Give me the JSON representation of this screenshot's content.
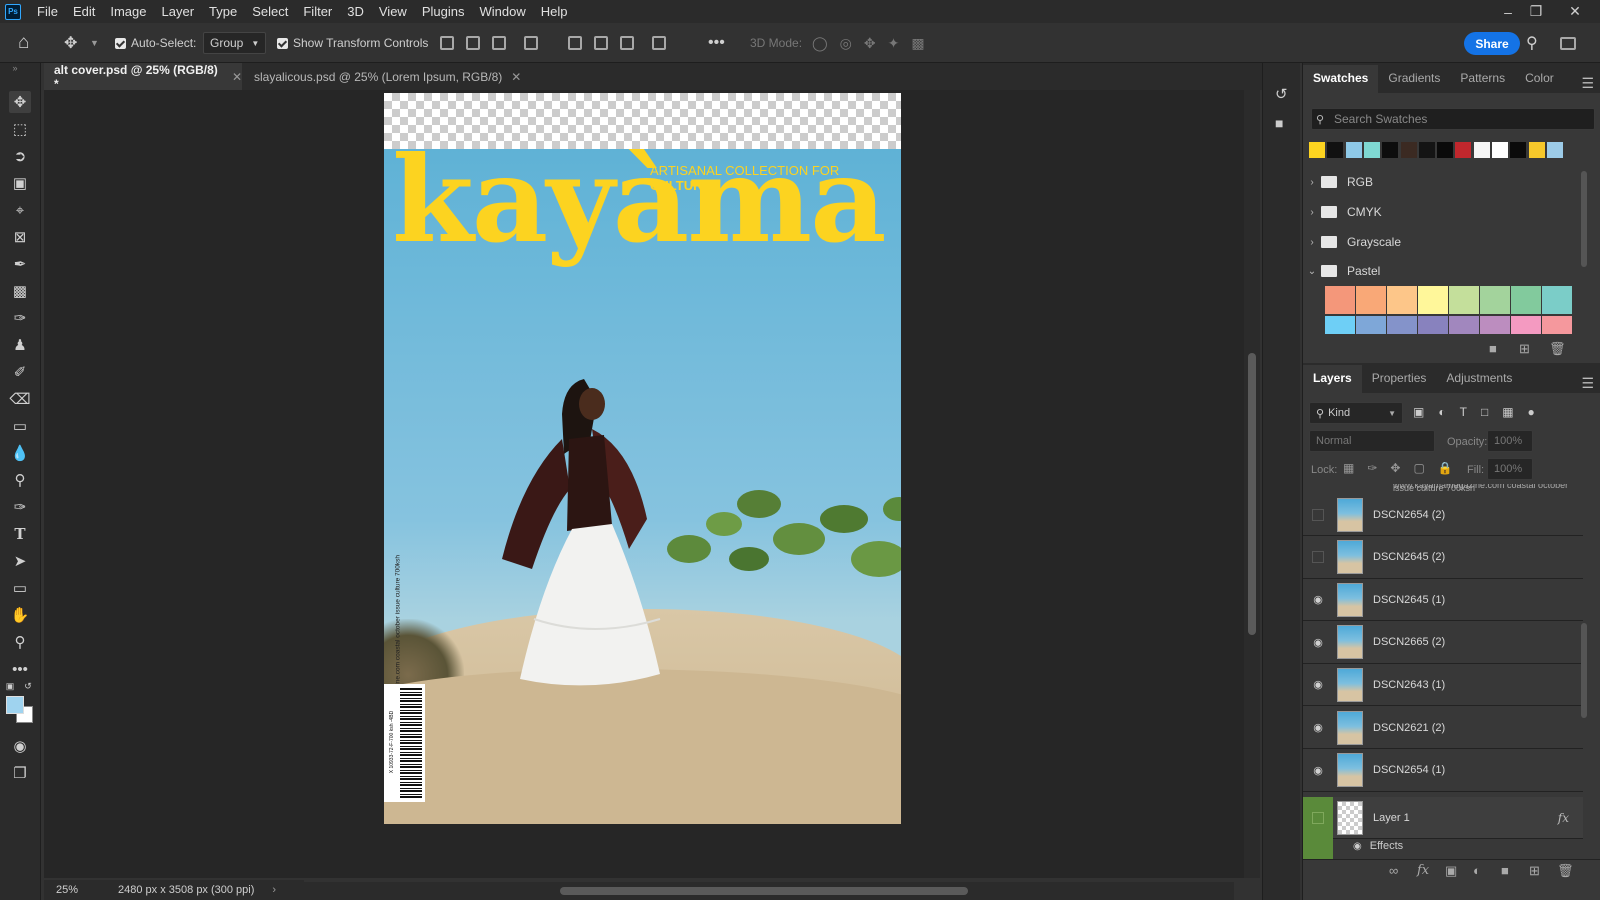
{
  "menu": {
    "logo": "Ps",
    "items": [
      "File",
      "Edit",
      "Image",
      "Layer",
      "Type",
      "Select",
      "Filter",
      "3D",
      "View",
      "Plugins",
      "Window",
      "Help"
    ]
  },
  "options": {
    "auto_select_label": "Auto-Select:",
    "auto_select_value": "Group",
    "transform_label": "Show Transform Controls",
    "mode_3d_label": "3D Mode:",
    "share_label": "Share"
  },
  "tabs": [
    {
      "label": "alt cover.psd @ 25% (RGB/8) *"
    },
    {
      "label": "slayalicous.psd @ 25% (Lorem Ipsum, RGB/8)"
    }
  ],
  "cover": {
    "masthead": "kayàma",
    "tagline_pre": "ARTISANAL COLLECTION FOR ",
    "tagline_bold": "CULTURE",
    "spine": "www.kayamamagazine.com coastal october issue culture 700ksh",
    "barcode_num": "X 10933-72-F-700 ksh -4BD"
  },
  "status": {
    "zoom": "25%",
    "doc_info": "2480 px x 3508 px (300 ppi)"
  },
  "swatches_panel": {
    "tabs": [
      "Swatches",
      "Gradients",
      "Patterns",
      "Color"
    ],
    "search_placeholder": "Search Swatches",
    "top_colors": [
      "#fcd320",
      "#111111",
      "#8ec9e8",
      "#7fd8d2",
      "#0d0d0d",
      "#3b2a22",
      "#141414",
      "#0a0a0a",
      "#c1272d",
      "#f4f4f4",
      "#ffffff",
      "#0b0b0b",
      "#f6c82b",
      "#9ccbe8"
    ],
    "folders": [
      "RGB",
      "CMYK",
      "Grayscale",
      "Pastel"
    ],
    "pastel_row1": [
      "#f4977a",
      "#f9a877",
      "#fdc689",
      "#fff79a",
      "#c4df9b",
      "#a3d39c",
      "#82ca9d",
      "#7bcdc8"
    ],
    "pastel_row2": [
      "#6ecff6",
      "#7ea7d8",
      "#8493ca",
      "#8882be",
      "#a187be",
      "#bc8dbf",
      "#f49ac1",
      "#f5989d"
    ]
  },
  "layers_panel": {
    "tabs": [
      "Layers",
      "Properties",
      "Adjustments"
    ],
    "filter_kind": "Kind",
    "blend_mode": "Normal",
    "opacity_label": "Opacity:",
    "opacity_value": "100%",
    "lock_label": "Lock:",
    "fill_label": "Fill:",
    "fill_value": "100%",
    "clipped_text": "www.kayamamagazine.com coastal october issue culture 700ksh",
    "layers": [
      {
        "name": "DSCN2654 (2)",
        "visible": false
      },
      {
        "name": "DSCN2645 (2)",
        "visible": false
      },
      {
        "name": "DSCN2645 (1)",
        "visible": true
      },
      {
        "name": "DSCN2665 (2)",
        "visible": true
      },
      {
        "name": "DSCN2643 (1)",
        "visible": true
      },
      {
        "name": "DSCN2621 (2)",
        "visible": true
      },
      {
        "name": "DSCN2654 (1)",
        "visible": true
      }
    ],
    "layer1_name": "Layer 1",
    "effects_label": "Effects",
    "fx_label": "fx"
  }
}
